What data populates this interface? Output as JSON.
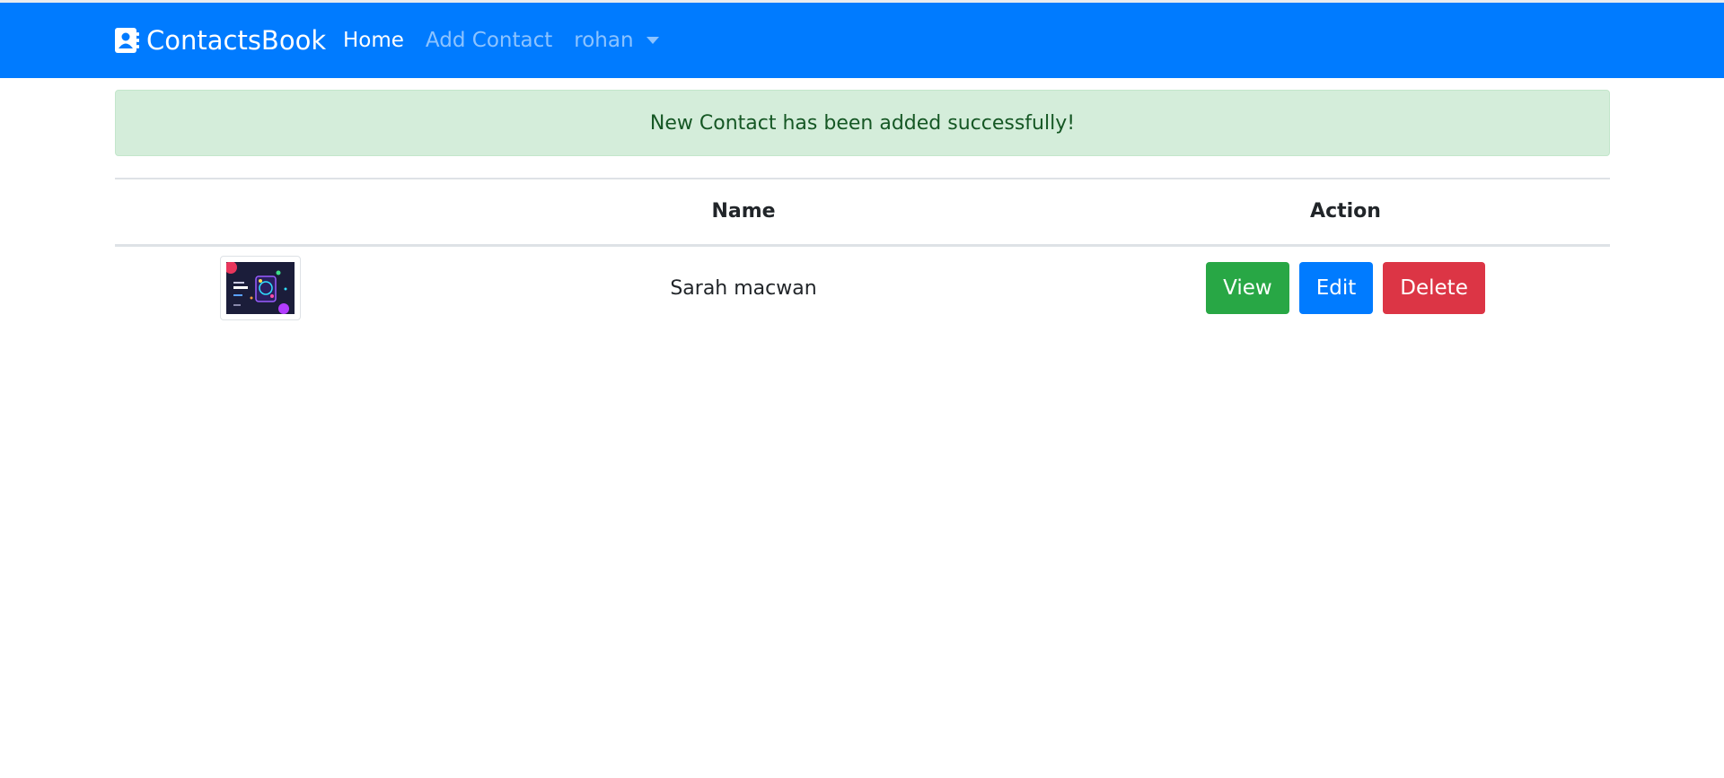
{
  "navbar": {
    "brand": "ContactsBook",
    "links": [
      {
        "label": "Home",
        "active": true
      },
      {
        "label": "Add Contact",
        "active": false
      }
    ],
    "user": "rohan"
  },
  "alert": {
    "message": "New Contact has been added successfully!"
  },
  "table": {
    "headers": [
      "",
      "Name",
      "Action"
    ],
    "rows": [
      {
        "name": "Sarah macwan",
        "actions": [
          "View",
          "Edit",
          "Delete"
        ]
      }
    ]
  },
  "colors": {
    "navbar": "#007bff",
    "alert_bg": "#d4edda",
    "alert_text": "#155724",
    "view": "#28a745",
    "edit": "#007bff",
    "delete": "#dc3545"
  },
  "icons": {
    "brand": "contact-book-icon",
    "dropdown": "caret-down-icon"
  }
}
